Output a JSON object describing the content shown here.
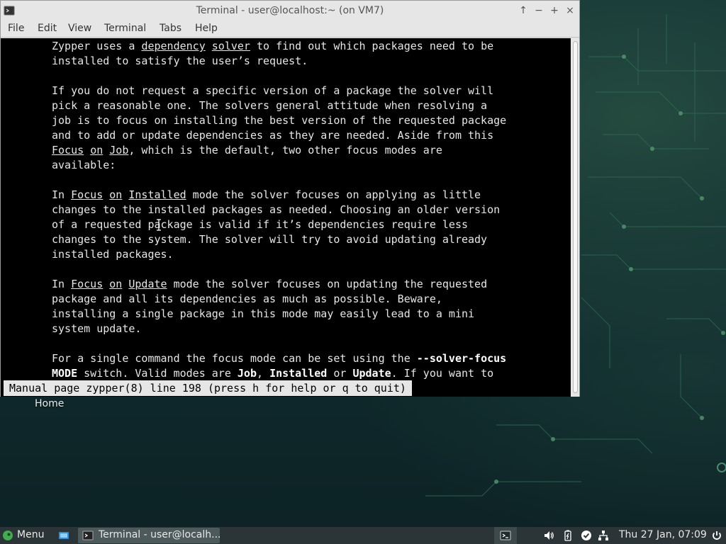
{
  "window": {
    "title": "Terminal - user@localhost:~ (on VM7)",
    "controls": {
      "keep_above": "↑",
      "minimize": "−",
      "maximize": "+",
      "close": "×"
    }
  },
  "menubar": [
    "File",
    "Edit",
    "View",
    "Terminal",
    "Tabs",
    "Help"
  ],
  "terminal": {
    "lines": [
      [
        {
          "t": "Zypper uses a "
        },
        {
          "t": "dependency",
          "s": "u"
        },
        {
          "t": " "
        },
        {
          "t": "solver",
          "s": "u"
        },
        {
          "t": " to find out which packages need to be"
        }
      ],
      [
        {
          "t": "installed to satisfy the user’s request."
        }
      ],
      [],
      [
        {
          "t": "If you do not request a specific version of a package the solver will"
        }
      ],
      [
        {
          "t": "pick a reasonable one. The solvers general attitude when resolving a"
        }
      ],
      [
        {
          "t": "job is to focus on installing the best version of the requested package"
        }
      ],
      [
        {
          "t": "and to add or update dependencies as they are needed. Aside from this"
        }
      ],
      [
        {
          "t": "Focus",
          "s": "u"
        },
        {
          "t": " "
        },
        {
          "t": "on",
          "s": "u"
        },
        {
          "t": " "
        },
        {
          "t": "Job",
          "s": "u"
        },
        {
          "t": ", which is the default, two other focus modes are"
        }
      ],
      [
        {
          "t": "available:"
        }
      ],
      [],
      [
        {
          "t": "In "
        },
        {
          "t": "Focus",
          "s": "u"
        },
        {
          "t": " "
        },
        {
          "t": "on",
          "s": "u"
        },
        {
          "t": " "
        },
        {
          "t": "Installed",
          "s": "u"
        },
        {
          "t": " mode the solver focuses on applying as little"
        }
      ],
      [
        {
          "t": "changes to the installed packages as needed. Choosing an older version"
        }
      ],
      [
        {
          "t": "of a requested package is valid if it’s dependencies require less"
        }
      ],
      [
        {
          "t": "changes to the system. The solver will try to avoid updating already"
        }
      ],
      [
        {
          "t": "installed packages."
        }
      ],
      [],
      [
        {
          "t": "In "
        },
        {
          "t": "Focus",
          "s": "u"
        },
        {
          "t": " "
        },
        {
          "t": "on",
          "s": "u"
        },
        {
          "t": " "
        },
        {
          "t": "Update",
          "s": "u"
        },
        {
          "t": " mode the solver focuses on updating the requested"
        }
      ],
      [
        {
          "t": "package and all its dependencies as much as possible. Beware,"
        }
      ],
      [
        {
          "t": "installing a single package in this mode may easily lead to a mini"
        }
      ],
      [
        {
          "t": "system update."
        }
      ],
      [],
      [
        {
          "t": "For a single command the focus mode can be set using the "
        },
        {
          "t": "--solver-focus",
          "s": "b"
        }
      ],
      [
        {
          "t": "MODE",
          "s": "b"
        },
        {
          "t": " switch. Valid modes are "
        },
        {
          "t": "Job",
          "s": "b"
        },
        {
          "t": ", "
        },
        {
          "t": "Installed",
          "s": "b"
        },
        {
          "t": " or "
        },
        {
          "t": "Update",
          "s": "b"
        },
        {
          "t": ". If you want to"
        }
      ]
    ],
    "status": "Manual page zypper(8) line 198 (press h for help or q to quit)"
  },
  "desktop": {
    "icon_label": "Home"
  },
  "taskbar": {
    "menu_label": "Menu",
    "task_label": "Terminal - user@localh...",
    "clock": "Thu 27 Jan, 07:09"
  },
  "colors": {
    "terminal_bg": "#000000",
    "terminal_fg": "#e6e6e6",
    "taskbar_bg": "#2b3436",
    "accent_green": "#3fae4d"
  },
  "icons": [
    "terminal-app-icon",
    "menu-logo-icon",
    "file-manager-icon",
    "volume-icon",
    "battery-icon",
    "check-icon",
    "network-icon",
    "power-icon"
  ]
}
